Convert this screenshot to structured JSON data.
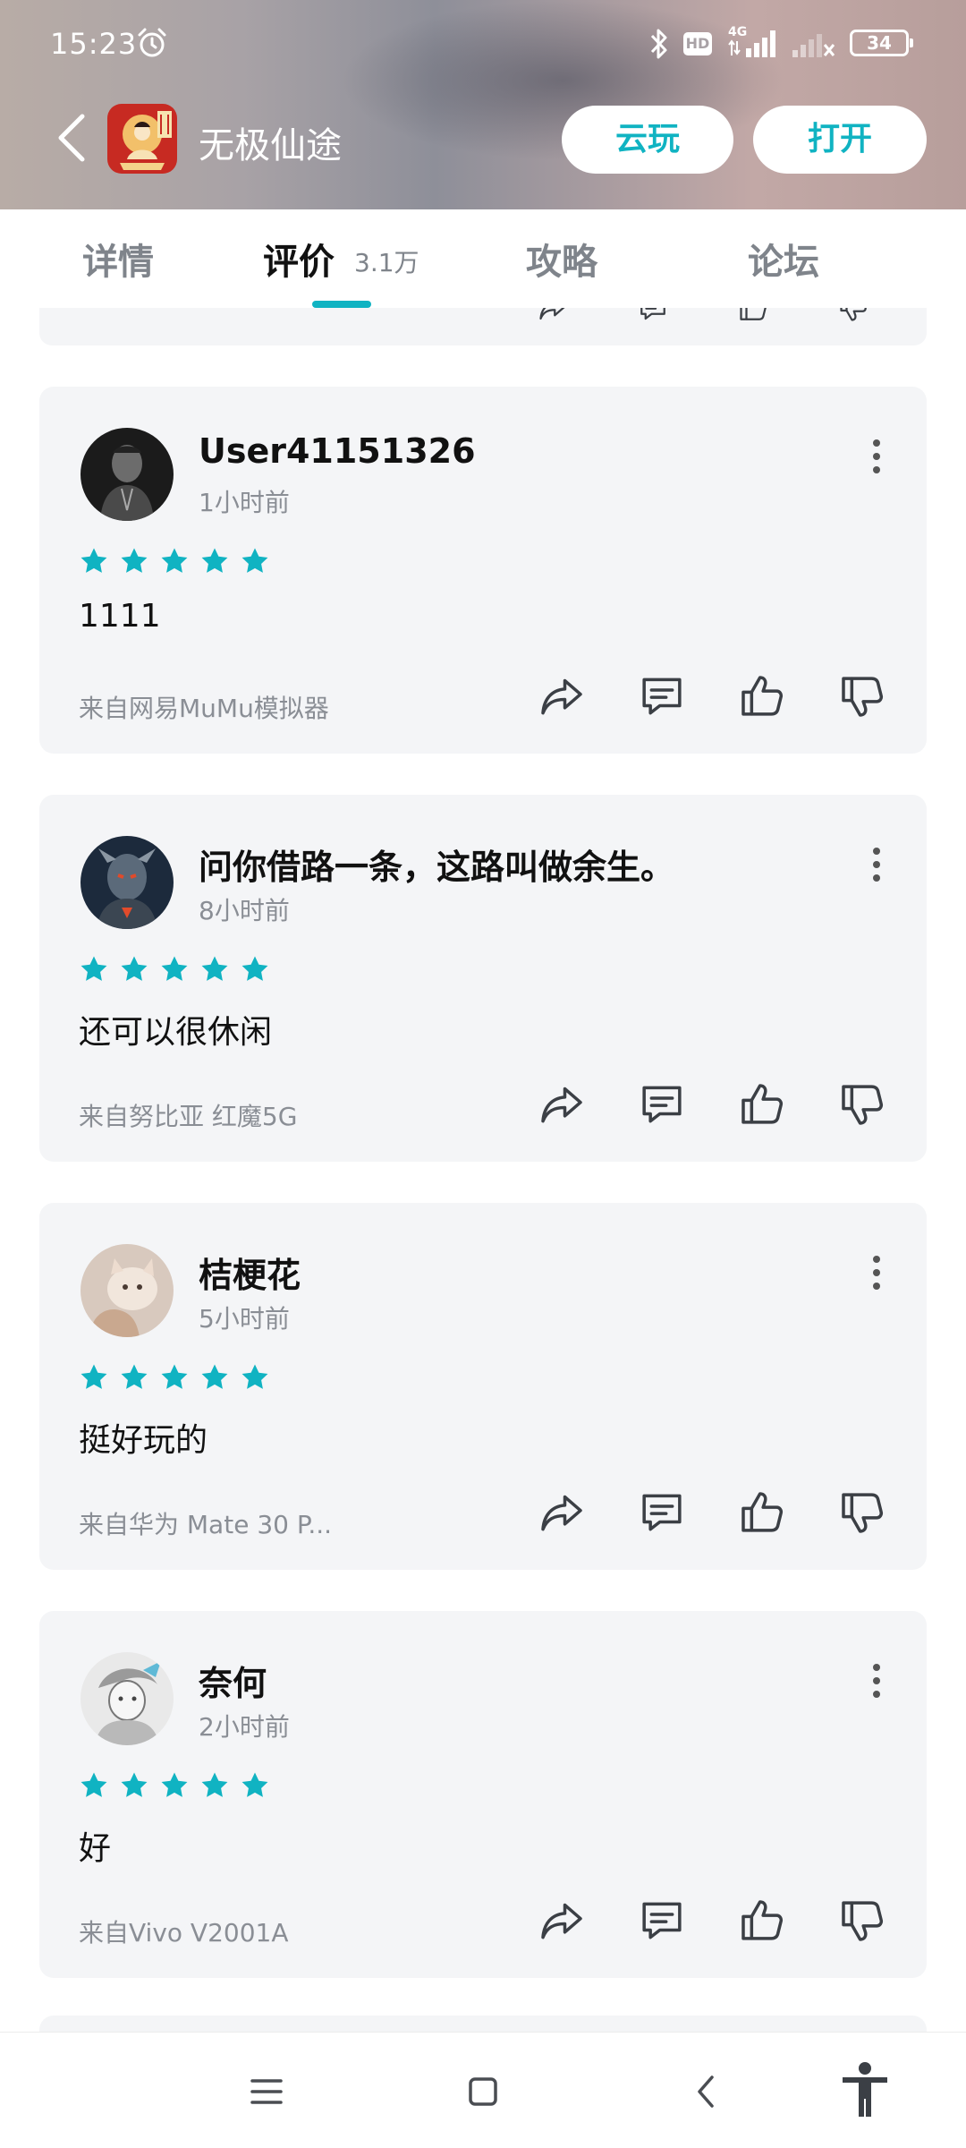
{
  "status_bar": {
    "time": "15:23",
    "hd": "HD",
    "network": "4G",
    "battery": "34"
  },
  "app_bar": {
    "title": "无极仙途",
    "cloud_play_label": "云玩",
    "open_label": "打开"
  },
  "tabs": {
    "details": "详情",
    "reviews": "评价",
    "reviews_count": "3.1万",
    "guide": "攻略",
    "forum": "论坛",
    "active": "reviews"
  },
  "colors": {
    "accent": "#10b3c2",
    "card_bg": "#f4f5f7",
    "muted_text": "#8a8e95"
  },
  "reviews": [
    {
      "user": "User41151326",
      "time_ago": "1小时前",
      "rating": 5,
      "content": "1111",
      "source": "来自网易MuMu模拟器"
    },
    {
      "user": "问你借路一条，这路叫做余生。",
      "time_ago": "8小时前",
      "rating": 5,
      "content": "还可以很休闲",
      "source": "来自努比亚 红魔5G"
    },
    {
      "user": "桔梗花",
      "time_ago": "5小时前",
      "rating": 5,
      "content": "挺好玩的",
      "source": "来自华为 Mate 30 P..."
    },
    {
      "user": "奈何",
      "time_ago": "2小时前",
      "rating": 5,
      "content": "好",
      "source": "来自Vivo V2001A"
    }
  ],
  "icons": {
    "review_actions": [
      "share-icon",
      "comment-icon",
      "thumbs-up-icon",
      "thumbs-down-icon"
    ],
    "bottom_nav": [
      "menu-icon",
      "home-icon",
      "back-icon",
      "accessibility-icon"
    ]
  }
}
